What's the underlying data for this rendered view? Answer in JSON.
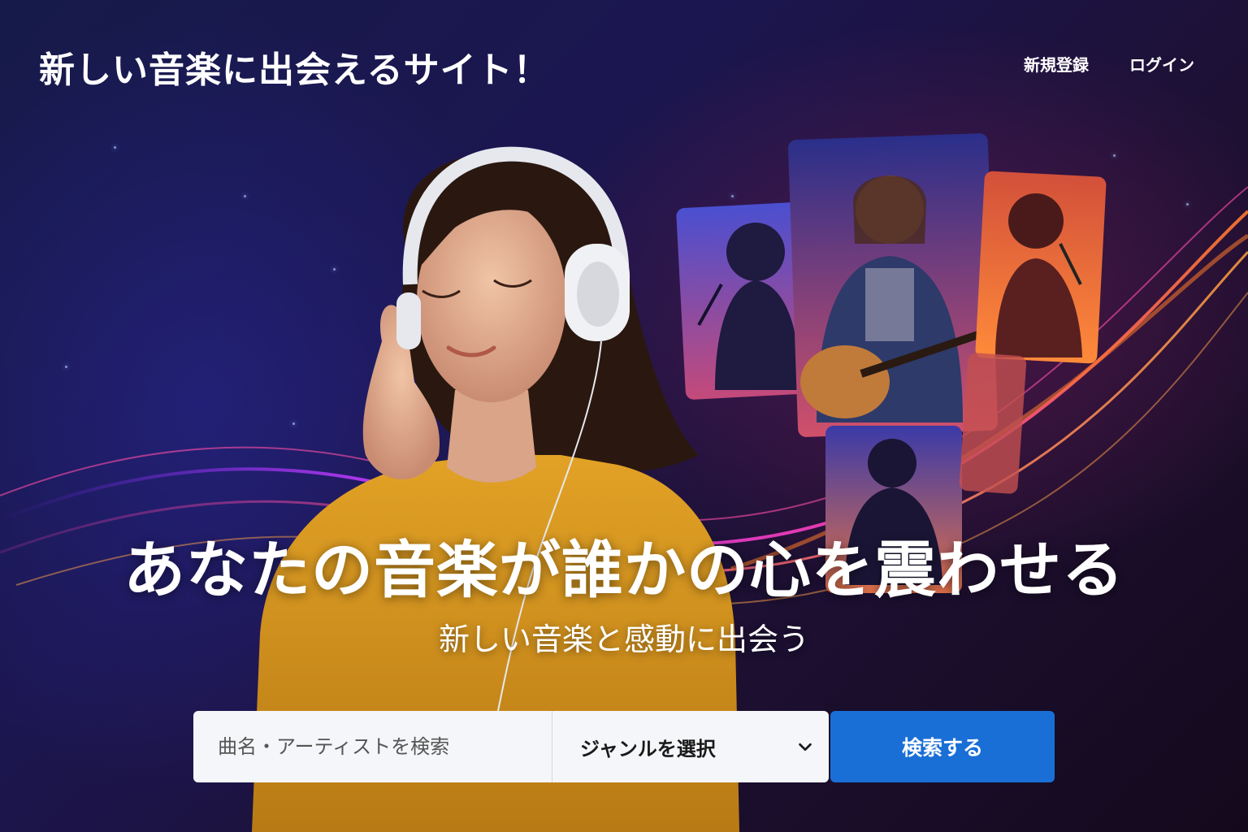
{
  "header": {
    "site_title": "新しい音楽に出会えるサイト！",
    "nav": [
      {
        "label": "新規登録"
      },
      {
        "label": "ログイン"
      }
    ]
  },
  "hero": {
    "headline": "あなたの音楽が誰かの心を震わせる",
    "subheadline": "新しい音楽と感動に出会う"
  },
  "search": {
    "placeholder": "曲名・アーティストを検索",
    "genre_label": "ジャンルを選択",
    "button_label": "検索する"
  },
  "colors": {
    "accent": "#1a6fd6",
    "sweater": "#d99a1e",
    "glow_pink": "#ff3fb4",
    "glow_orange": "#ff7a2a"
  },
  "icons": {
    "genre_dropdown": "chevron-down-icon",
    "headphones": "headphones-icon"
  }
}
